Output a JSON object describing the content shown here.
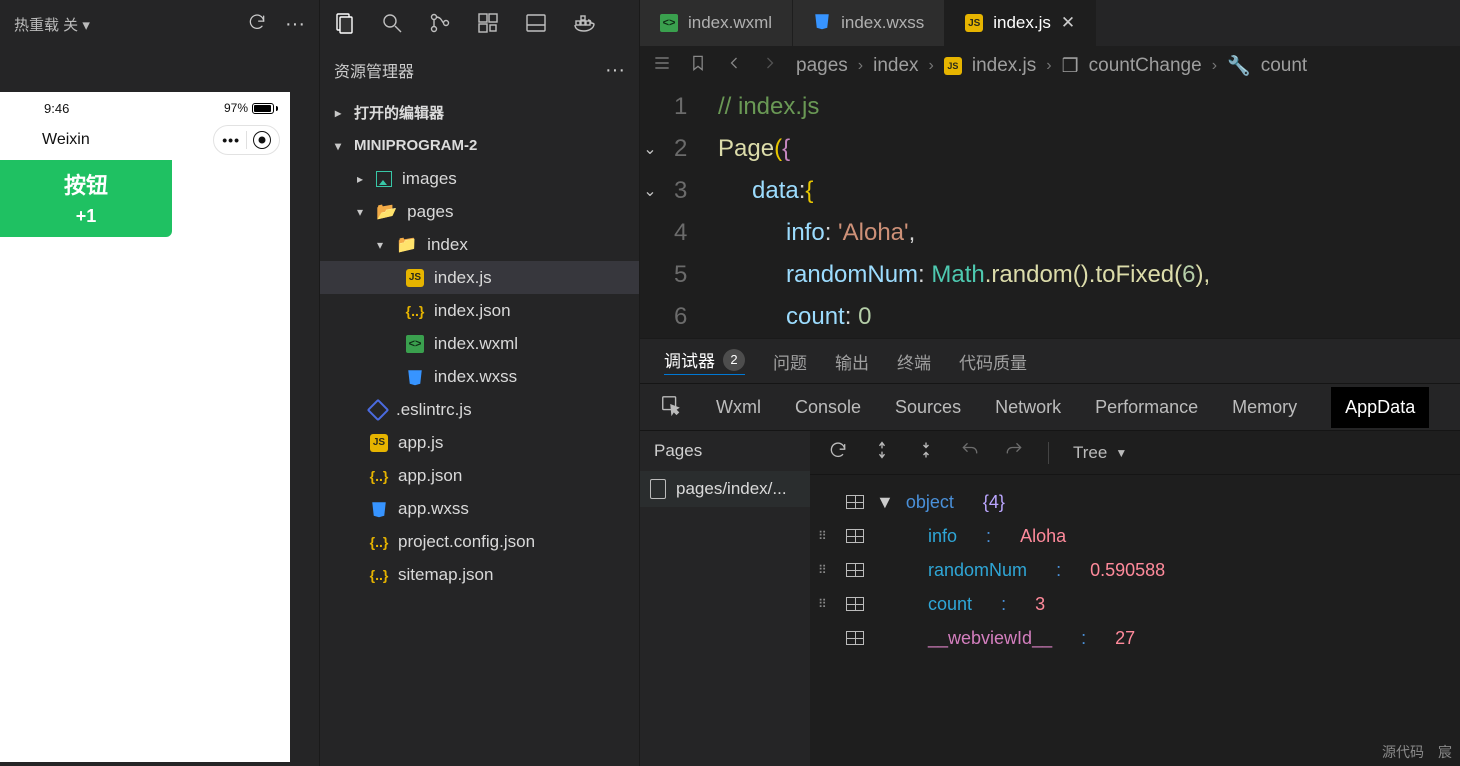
{
  "simulator": {
    "hotReload": "热重载 关",
    "statusTime": "9:46",
    "batteryPct": "97%",
    "appTitle": "Weixin",
    "btnLabel": "按钮",
    "plusOne": "+1"
  },
  "explorer": {
    "title": "资源管理器",
    "openEditors": "打开的编辑器",
    "project": "MINIPROGRAM-2",
    "tree": {
      "images": "images",
      "pages": "pages",
      "index": "index",
      "indexjs": "index.js",
      "indexjson": "index.json",
      "indexwxml": "index.wxml",
      "indexwxss": "index.wxss",
      "eslint": ".eslintrc.js",
      "appjs": "app.js",
      "appjson": "app.json",
      "appwxss": "app.wxss",
      "projcfg": "project.config.json",
      "sitemap": "sitemap.json"
    }
  },
  "tabs": {
    "wxml": "index.wxml",
    "wxss": "index.wxss",
    "js": "index.js"
  },
  "breadcrumb": {
    "pages": "pages",
    "index": "index",
    "file": "index.js",
    "fn": "countChange",
    "var": "count"
  },
  "code": {
    "l1": "// index.js",
    "l2a": "Page",
    "l2b": "(",
    "l2c": "{",
    "l3a": "data",
    "l3b": ":",
    "l3c": " {",
    "l4a": "info",
    "l4b": ":",
    "l4str": "'Aloha'",
    "l4c": ",",
    "l5a": "randomNum",
    "l5b": ":",
    "l5m": "Math",
    "l5r": ".random().toFixed(",
    "l5n": "6",
    "l5e": "),",
    "l6a": "count",
    "l6b": ":",
    "l6n": "0"
  },
  "panelTabs": {
    "debugger": "调试器",
    "debuggerBadge": "2",
    "problems": "问题",
    "output": "输出",
    "terminal": "终端",
    "codeQuality": "代码质量"
  },
  "devtoolTabs": {
    "wxml": "Wxml",
    "console": "Console",
    "sources": "Sources",
    "network": "Network",
    "performance": "Performance",
    "memory": "Memory",
    "appdata": "AppData"
  },
  "pagesPane": {
    "header": "Pages",
    "item": "pages/index/..."
  },
  "dataTools": {
    "treeLabel": "Tree"
  },
  "appdata": {
    "objLabel": "object",
    "objCount": "{4}",
    "info_k": "info",
    "info_v": "Aloha",
    "random_k": "randomNum",
    "random_v": "0.590588",
    "count_k": "count",
    "count_v": "3",
    "wv_k": "__webviewId__",
    "wv_v": "27"
  },
  "footer": {
    "source": "源代码",
    "author": "宸"
  }
}
